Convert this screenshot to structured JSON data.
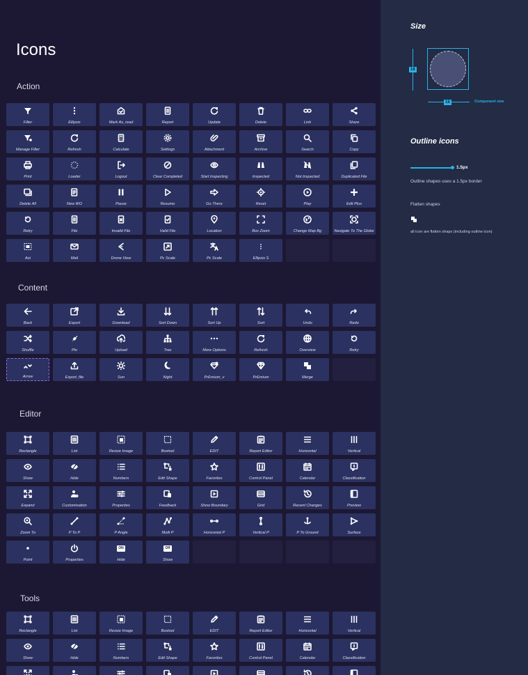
{
  "page": {
    "title": "Icons"
  },
  "sections": [
    {
      "title": "Action",
      "tiles": [
        {
          "label": "Filter",
          "icon": "filter-icon"
        },
        {
          "label": "Ellipsis",
          "icon": "ellipsis-icon"
        },
        {
          "label": "Mark As_read",
          "icon": "mark-read-icon"
        },
        {
          "label": "Report",
          "icon": "report-icon"
        },
        {
          "label": "Update",
          "icon": "update-icon"
        },
        {
          "label": "Delete",
          "icon": "delete-icon"
        },
        {
          "label": "Link",
          "icon": "link-icon"
        },
        {
          "label": "Share",
          "icon": "share-icon"
        },
        {
          "label": "Manage Filter",
          "icon": "manage-filter-icon"
        },
        {
          "label": "Refresh",
          "icon": "refresh-icon"
        },
        {
          "label": "Calculate",
          "icon": "calculate-icon"
        },
        {
          "label": "Settings",
          "icon": "settings-icon"
        },
        {
          "label": "Attachment",
          "icon": "attachment-icon"
        },
        {
          "label": "Archive",
          "icon": "archive-icon"
        },
        {
          "label": "Search",
          "icon": "search-icon"
        },
        {
          "label": "Copy",
          "icon": "copy-icon"
        },
        {
          "label": "Print",
          "icon": "print-icon"
        },
        {
          "label": "Loader",
          "icon": "loader-icon"
        },
        {
          "label": "Logout",
          "icon": "logout-icon"
        },
        {
          "label": "Clear Completed",
          "icon": "clear-completed-icon"
        },
        {
          "label": "Start Inspecting",
          "icon": "start-inspecting-icon"
        },
        {
          "label": "Inspected",
          "icon": "inspected-icon"
        },
        {
          "label": "Not Inspected",
          "icon": "not-inspected-icon"
        },
        {
          "label": "Duplicated File",
          "icon": "duplicated-file-icon"
        },
        {
          "label": "Delete All",
          "icon": "delete-all-icon"
        },
        {
          "label": "New WO",
          "icon": "new-wo-icon"
        },
        {
          "label": "Pause",
          "icon": "pause-icon"
        },
        {
          "label": "Resume",
          "icon": "resume-icon"
        },
        {
          "label": "Go There",
          "icon": "go-there-icon"
        },
        {
          "label": "Reset",
          "icon": "reset-icon"
        },
        {
          "label": "Play",
          "icon": "play-icon"
        },
        {
          "label": "Edit Plus",
          "icon": "edit-plus-icon"
        },
        {
          "label": "Retry",
          "icon": "retry-icon"
        },
        {
          "label": "File",
          "icon": "file-icon"
        },
        {
          "label": "Invalid File",
          "icon": "invalid-file-icon"
        },
        {
          "label": "Valid File",
          "icon": "valid-file-icon"
        },
        {
          "label": "Location",
          "icon": "location-icon"
        },
        {
          "label": "Box Zoom",
          "icon": "box-zoom-icon"
        },
        {
          "label": "Change Map Bg",
          "icon": "change-map-bg-icon"
        },
        {
          "label": "Navigate To The Globe",
          "icon": "navigate-globe-icon"
        },
        {
          "label": "Aoi",
          "icon": "aoi-icon"
        },
        {
          "label": "Mail",
          "icon": "mail-icon"
        },
        {
          "label": "Drone View",
          "icon": "drone-view-icon"
        },
        {
          "label": "Pc Scale",
          "icon": "pc-scale-icon"
        },
        {
          "label": "Pc Scale",
          "icon": "pc-scale-translate-icon"
        },
        {
          "label": "Ellipsis S",
          "icon": "ellipsis-s-icon"
        },
        {
          "empty": true
        },
        {
          "empty": true
        }
      ]
    },
    {
      "title": "Content",
      "tiles": [
        {
          "label": "Back",
          "icon": "back-icon"
        },
        {
          "label": "Export",
          "icon": "export-icon"
        },
        {
          "label": "Download",
          "icon": "download-icon"
        },
        {
          "label": "Sort Down",
          "icon": "sort-down-icon"
        },
        {
          "label": "Sort Up",
          "icon": "sort-up-icon"
        },
        {
          "label": "Sort",
          "icon": "sort-icon"
        },
        {
          "label": "Undo",
          "icon": "undo-icon"
        },
        {
          "label": "Redo",
          "icon": "redo-icon"
        },
        {
          "label": "Shuffle",
          "icon": "shuffle-icon"
        },
        {
          "label": "Pin",
          "icon": "pin-icon"
        },
        {
          "label": "Upload",
          "icon": "upload-icon"
        },
        {
          "label": "Tree",
          "icon": "tree-icon"
        },
        {
          "label": "More Options",
          "icon": "more-options-icon"
        },
        {
          "label": "Refresh",
          "icon": "refresh-icon"
        },
        {
          "label": "Overview",
          "icon": "overview-icon"
        },
        {
          "label": "Retry",
          "icon": "retry-icon"
        },
        {
          "label": "Arrow",
          "icon": "arrow-icon"
        },
        {
          "label": "Export_file",
          "icon": "export-file-icon"
        },
        {
          "label": "Sun",
          "icon": "sun-icon"
        },
        {
          "label": "Night",
          "icon": "night-icon"
        },
        {
          "label": "PrEmium_v",
          "icon": "premium-v-icon"
        },
        {
          "label": "PrEmium",
          "icon": "premium-icon"
        },
        {
          "label": "Merge",
          "icon": "merge-icon"
        },
        {
          "empty": true
        }
      ]
    },
    {
      "title": "Editor",
      "tiles": [
        {
          "label": "Rectangle",
          "icon": "rectangle-icon"
        },
        {
          "label": "List",
          "icon": "list-icon"
        },
        {
          "label": "Resize Image",
          "icon": "resize-image-icon"
        },
        {
          "label": "Boxtool",
          "icon": "boxtool-icon"
        },
        {
          "label": "EDIT",
          "icon": "edit-icon"
        },
        {
          "label": "Report Editor",
          "icon": "report-editor-icon"
        },
        {
          "label": "Horizontal",
          "icon": "horizontal-icon"
        },
        {
          "label": "Vertical",
          "icon": "vertical-icon"
        },
        {
          "label": "Show",
          "icon": "show-icon"
        },
        {
          "label": "Hide",
          "icon": "hide-icon"
        },
        {
          "label": "Numbers",
          "icon": "numbers-icon"
        },
        {
          "label": "Edit Shape",
          "icon": "edit-shape-icon"
        },
        {
          "label": "Favorites",
          "icon": "favorites-icon"
        },
        {
          "label": "Control Panel",
          "icon": "control-panel-icon"
        },
        {
          "label": "Calendar",
          "icon": "calendar-icon"
        },
        {
          "label": "Classification",
          "icon": "classification-icon"
        },
        {
          "label": "Expand",
          "icon": "expand-icon"
        },
        {
          "label": "Customisation",
          "icon": "customisation-icon"
        },
        {
          "label": "Properties",
          "icon": "properties-icon"
        },
        {
          "label": "Feedback",
          "icon": "feedback-icon"
        },
        {
          "label": "Show Boundary",
          "icon": "show-boundary-icon"
        },
        {
          "label": "Grid",
          "icon": "grid-icon"
        },
        {
          "label": "Recent Changes",
          "icon": "recent-changes-icon"
        },
        {
          "label": "Preview",
          "icon": "preview-icon"
        },
        {
          "label": "Zoom To",
          "icon": "zoom-to-icon"
        },
        {
          "label": "P To P",
          "icon": "p-to-p-icon"
        },
        {
          "label": "P Angle",
          "icon": "p-angle-icon"
        },
        {
          "label": "Multi  P",
          "icon": "multi-p-icon"
        },
        {
          "label": "Horizontal P",
          "icon": "horizontal-p-icon"
        },
        {
          "label": "Vertical P",
          "icon": "vertical-p-icon"
        },
        {
          "label": "P To Ground",
          "icon": "p-to-ground-icon"
        },
        {
          "label": "Surface",
          "icon": "surface-icon"
        },
        {
          "label": "Point",
          "icon": "point-icon"
        },
        {
          "label": "Properties",
          "icon": "power-icon"
        },
        {
          "label": "Hide",
          "icon": "on-badge-icon",
          "badge": "ON"
        },
        {
          "label": "Show",
          "icon": "off-badge-icon",
          "badge": "Off"
        },
        {
          "empty": true
        },
        {
          "empty": true
        },
        {
          "empty": true
        },
        {
          "empty": true
        }
      ]
    },
    {
      "title": "Tools",
      "tiles": [
        {
          "label": "Rectangle",
          "icon": "rectangle-icon"
        },
        {
          "label": "List",
          "icon": "list-icon"
        },
        {
          "label": "Resize Image",
          "icon": "resize-image-icon"
        },
        {
          "label": "Boxtool",
          "icon": "boxtool-icon"
        },
        {
          "label": "EDIT",
          "icon": "edit-icon"
        },
        {
          "label": "Report Editor",
          "icon": "report-editor-icon"
        },
        {
          "label": "Horizontal",
          "icon": "horizontal-icon"
        },
        {
          "label": "Vertical",
          "icon": "vertical-icon"
        },
        {
          "label": "Show",
          "icon": "show-icon"
        },
        {
          "label": "Hide",
          "icon": "hide-icon"
        },
        {
          "label": "Numbers",
          "icon": "numbers-icon"
        },
        {
          "label": "Edit Shape",
          "icon": "edit-shape-icon"
        },
        {
          "label": "Favorites",
          "icon": "favorites-icon"
        },
        {
          "label": "Control Panel",
          "icon": "control-panel-icon"
        },
        {
          "label": "Calendar",
          "icon": "calendar-icon"
        },
        {
          "label": "Classification",
          "icon": "classification-icon"
        },
        {
          "label": "",
          "icon": "expand-icon"
        },
        {
          "label": "",
          "icon": "customisation-icon"
        },
        {
          "label": "",
          "icon": "properties-icon"
        },
        {
          "label": "",
          "icon": "feedback-icon"
        },
        {
          "label": "",
          "icon": "show-boundary-icon"
        },
        {
          "label": "",
          "icon": "grid-icon"
        },
        {
          "label": "",
          "icon": "recent-changes-icon"
        },
        {
          "label": "",
          "icon": "preview-icon"
        }
      ]
    }
  ],
  "panel": {
    "size_title": "Size",
    "size_value_vertical": "18",
    "size_value_horizontal": "18",
    "component_size_label": "Component size",
    "outline_title": "Outline icons",
    "border_value": "1.5px",
    "outline_desc": "Outline shapes uses a 1.5px border",
    "flatten_title": "Flatten shapes",
    "flatten_desc": "all icon are flatten shaps (including outline icon)"
  },
  "colors": {
    "accent": "#28b4e6",
    "tile": "#2b3160",
    "background": "#1c1833",
    "panel": "#232b45"
  }
}
